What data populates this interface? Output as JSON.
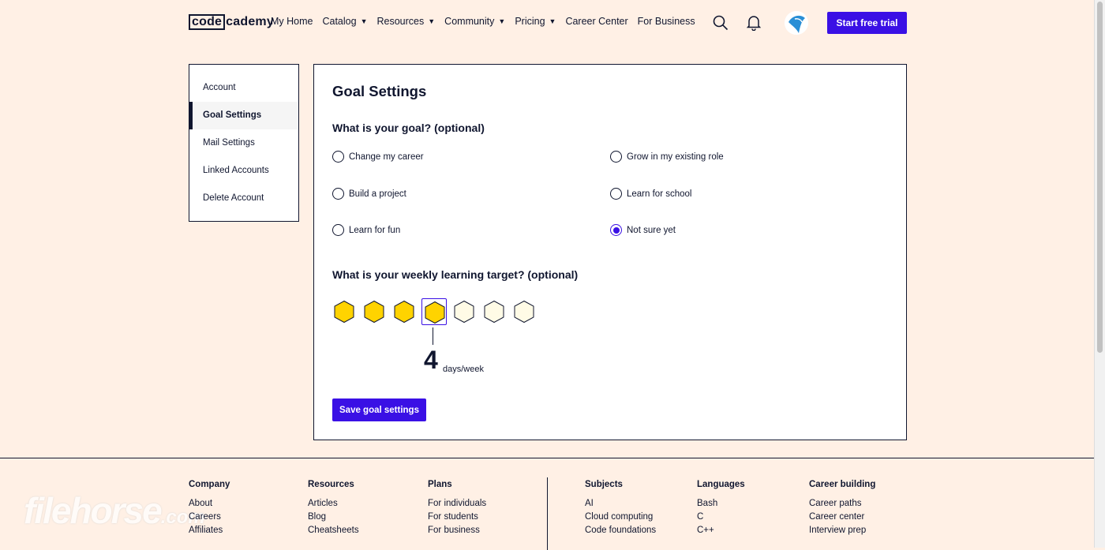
{
  "header": {
    "logo_left": "code",
    "logo_right": "cademy",
    "nav": [
      {
        "label": "My Home",
        "caret": false
      },
      {
        "label": "Catalog",
        "caret": true
      },
      {
        "label": "Resources",
        "caret": true
      },
      {
        "label": "Community",
        "caret": true
      },
      {
        "label": "Pricing",
        "caret": true
      },
      {
        "label": "Career Center",
        "caret": false
      },
      {
        "label": "For Business",
        "caret": false
      }
    ],
    "trial_button": "Start free trial",
    "icons": [
      "search-icon",
      "bell-icon",
      "avatar"
    ]
  },
  "sidebar": {
    "items": [
      "Account",
      "Goal Settings",
      "Mail Settings",
      "Linked Accounts",
      "Delete Account"
    ],
    "active": "Goal Settings"
  },
  "main": {
    "title": "Goal Settings",
    "goal_question": "What is your goal? (optional)",
    "goals": {
      "change_career": "Change my career",
      "grow_role": "Grow in my existing role",
      "build_project": "Build a project",
      "learn_school": "Learn for school",
      "learn_fun": "Learn for fun",
      "not_sure": "Not sure yet"
    },
    "selected_goal": "Not sure yet",
    "target_question": "What is your weekly learning target? (optional)",
    "days_total": 7,
    "days_selected": 4,
    "days_value": "4",
    "days_unit": "days/week",
    "save_button": "Save goal settings",
    "colors": {
      "accent": "#3a10e5",
      "hex_filled": "#ffd300",
      "hex_empty": "#fffbe6"
    }
  },
  "footer": {
    "company": {
      "title": "Company",
      "links": [
        "About",
        "Careers",
        "Affiliates"
      ]
    },
    "resources": {
      "title": "Resources",
      "links": [
        "Articles",
        "Blog",
        "Cheatsheets"
      ]
    },
    "plans": {
      "title": "Plans",
      "links": [
        "For individuals",
        "For students",
        "For business"
      ]
    },
    "subjects": {
      "title": "Subjects",
      "links": [
        "AI",
        "Cloud computing",
        "Code foundations"
      ]
    },
    "languages": {
      "title": "Languages",
      "links": [
        "Bash",
        "C",
        "C++"
      ]
    },
    "career": {
      "title": "Career building",
      "links": [
        "Career paths",
        "Career center",
        "Interview prep"
      ]
    },
    "watermark": "filehorse",
    "watermark_suffix": ".com"
  }
}
